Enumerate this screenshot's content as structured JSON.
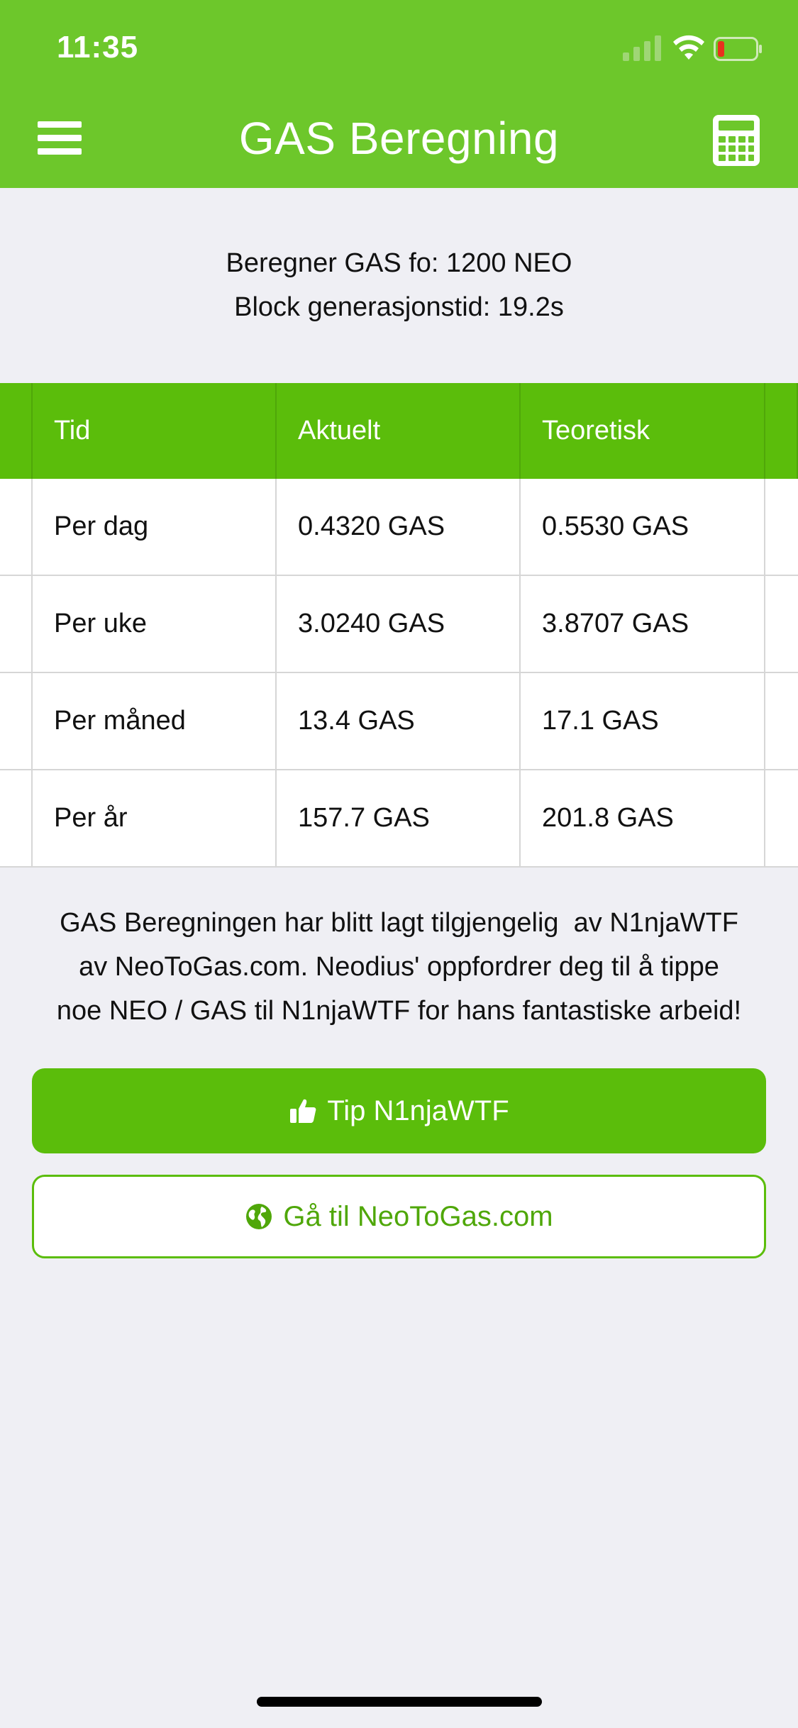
{
  "status_bar": {
    "time": "11:35"
  },
  "header": {
    "title": "GAS Beregning",
    "menu_icon": "hamburger-menu-icon",
    "calculator_icon": "calculator-icon"
  },
  "info": {
    "line1": "Beregner GAS fo: 1200 NEO",
    "line2": "Block generasjonstid: 19.2s"
  },
  "table": {
    "columns": [
      "Tid",
      "Aktuelt",
      "Teoretisk"
    ],
    "rows": [
      [
        "Per dag",
        "0.4320 GAS",
        "0.5530 GAS"
      ],
      [
        "Per uke",
        "3.0240 GAS",
        "3.8707 GAS"
      ],
      [
        "Per måned",
        "13.4 GAS",
        "17.1 GAS"
      ],
      [
        "Per år",
        "157.7 GAS",
        "201.8 GAS"
      ]
    ]
  },
  "note": {
    "line1": "GAS Beregningen har blitt lagt tilgjengelig  av N1njaWTF",
    "line2": "av NeoToGas.com. Neodius' oppfordrer deg til å tippe",
    "line3": "noe NEO / GAS til N1njaWTF for hans fantastiske arbeid!"
  },
  "buttons": {
    "tip_label": "Tip N1njaWTF",
    "tip_icon": "thumbs-up-icon",
    "link_label": "Gå til NeoToGas.com",
    "link_icon": "globe-icon"
  },
  "colors": {
    "header_green": "#6dc72b",
    "accent_green": "#5bbd0b",
    "background": "#efeff4"
  }
}
